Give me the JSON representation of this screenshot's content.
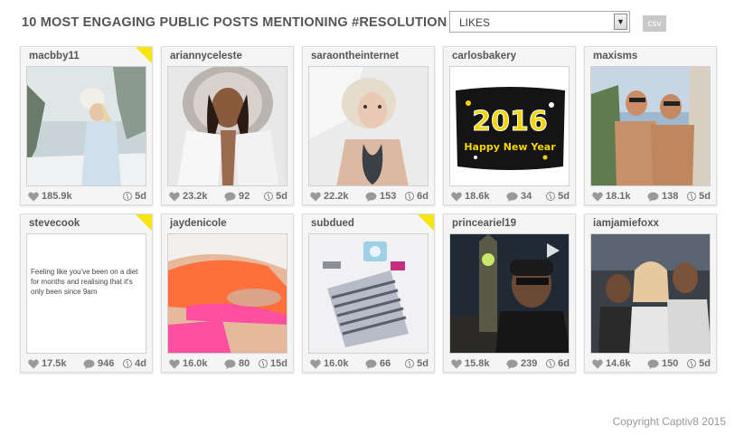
{
  "header": {
    "title": "10 MOST ENGAGING PUBLIC POSTS MENTIONING #RESOLUTION BY",
    "sort_select": {
      "value": "LIKES"
    },
    "csv_label": "csv"
  },
  "posts": [
    {
      "username": "macbby11",
      "likes": "185.9k",
      "comments": "",
      "age": "5d",
      "flagged": true,
      "icon": "heart-icon",
      "media": "photo-woman-snow"
    },
    {
      "username": "ariannyceleste",
      "likes": "23.2k",
      "comments": "92",
      "age": "5d",
      "flagged": false,
      "media": "photo-woman-white-parka"
    },
    {
      "username": "saraontheinternet",
      "likes": "22.2k",
      "comments": "153",
      "age": "6d",
      "flagged": false,
      "media": "photo-woman-in-bed"
    },
    {
      "username": "carlosbakery",
      "likes": "18.6k",
      "comments": "34",
      "age": "5d",
      "flagged": false,
      "media": "photo-2016-cake"
    },
    {
      "username": "maxisms",
      "likes": "18.1k",
      "comments": "138",
      "age": "5d",
      "flagged": false,
      "media": "photo-two-men-shirtless"
    },
    {
      "username": "stevecook",
      "likes": "17.5k",
      "comments": "946",
      "age": "4d",
      "flagged": true,
      "media": "text-post",
      "text": "Feeling like you've been on a diet for months and realising that it's only been since 9am"
    },
    {
      "username": "jaydenicole",
      "likes": "16.0k",
      "comments": "80",
      "age": "15d",
      "flagged": false,
      "media": "photo-bikini-body"
    },
    {
      "username": "subdued",
      "likes": "16.0k",
      "comments": "66",
      "age": "5d",
      "flagged": true,
      "media": "photo-flatlay-bag-camera"
    },
    {
      "username": "princeariel19",
      "likes": "15.8k",
      "comments": "239",
      "age": "6d",
      "flagged": false,
      "media": "video-big-ben-selfie",
      "video": true
    },
    {
      "username": "iamjamiefoxx",
      "likes": "14.6k",
      "comments": "150",
      "age": "5d",
      "flagged": false,
      "media": "photo-three-people"
    }
  ],
  "footer": {
    "copyright": "Copyright Captiv8 2015"
  },
  "colors": {
    "flag": "#f7e60d",
    "card_bg": "#f5f5f5",
    "text": "#555555"
  }
}
